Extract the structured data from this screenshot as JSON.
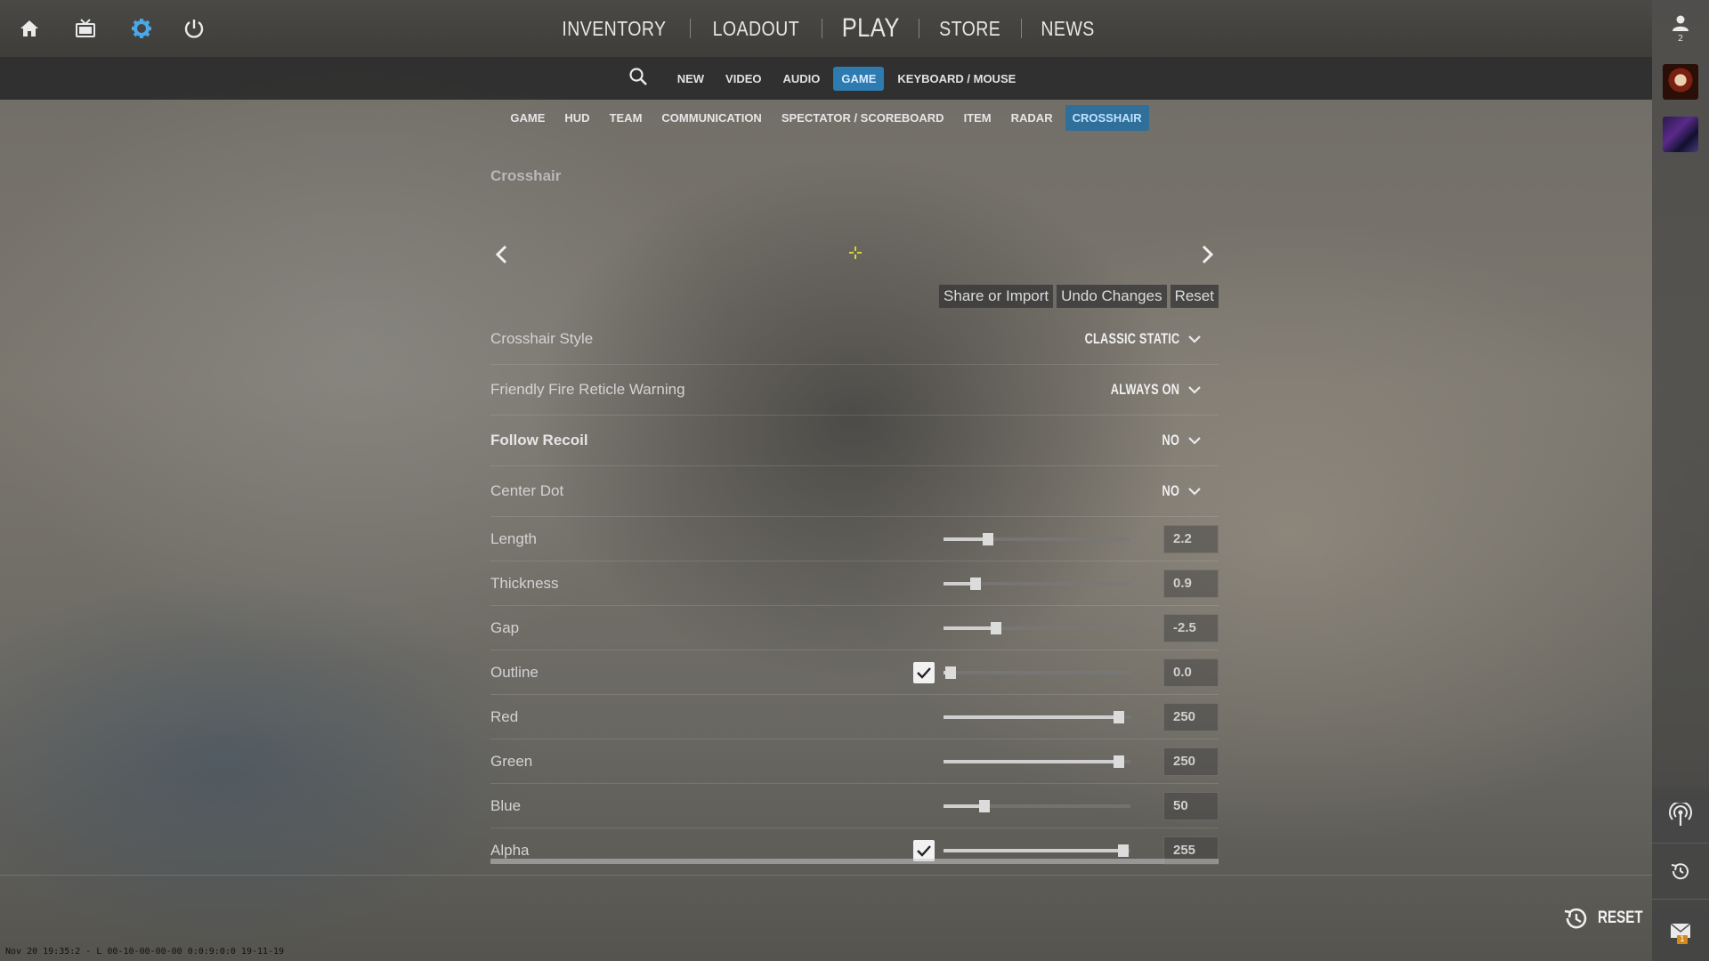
{
  "top_icons": [
    "home-icon",
    "tv-icon",
    "gear-icon",
    "power-icon"
  ],
  "main_nav": {
    "inventory": "INVENTORY",
    "loadout": "LOADOUT",
    "play": "PLAY",
    "store": "STORE",
    "news": "NEWS"
  },
  "sub_nav": {
    "tabs": [
      "NEW",
      "VIDEO",
      "AUDIO",
      "GAME",
      "KEYBOARD / MOUSE"
    ],
    "active": "GAME"
  },
  "section_nav": {
    "tabs": [
      "GAME",
      "HUD",
      "TEAM",
      "COMMUNICATION",
      "SPECTATOR / SCOREBOARD",
      "ITEM",
      "RADAR",
      "CROSSHAIR"
    ],
    "active": "CROSSHAIR"
  },
  "rail": {
    "friend_count": "2",
    "mail_badge": "1"
  },
  "panel": {
    "title": "Crosshair",
    "actions": {
      "share": "Share or Import",
      "undo": "Undo Changes",
      "reset": "Reset"
    },
    "dropdowns": [
      {
        "label": "Crosshair Style",
        "value": "CLASSIC STATIC",
        "bold": false
      },
      {
        "label": "Friendly Fire Reticle Warning",
        "value": "ALWAYS ON",
        "bold": false
      },
      {
        "label": "Follow Recoil",
        "value": "NO",
        "bold": true
      },
      {
        "label": "Center Dot",
        "value": "NO",
        "bold": false
      }
    ],
    "sliders": [
      {
        "label": "Length",
        "value": "2.2",
        "fraction": 0.24
      },
      {
        "label": "Thickness",
        "value": "0.9",
        "fraction": 0.17
      },
      {
        "label": "Gap",
        "value": "-2.5",
        "fraction": 0.28
      },
      {
        "label": "Outline",
        "value": "0.0",
        "fraction": 0.04,
        "checkbox": true
      },
      {
        "label": "Red",
        "value": "250",
        "fraction": 0.94
      },
      {
        "label": "Green",
        "value": "250",
        "fraction": 0.94
      },
      {
        "label": "Blue",
        "value": "50",
        "fraction": 0.22
      },
      {
        "label": "Alpha",
        "value": "255",
        "fraction": 0.96,
        "checkbox": true
      }
    ]
  },
  "footer": {
    "reset_label": "RESET",
    "debug_text": "Nov 20 19:35:2 - L 00-10-00-00-00 0:0:9:0:0 19-11-19"
  },
  "colors": {
    "accent_blue": "#2d7bb0",
    "crosshair_yellow": "#f5f032"
  }
}
